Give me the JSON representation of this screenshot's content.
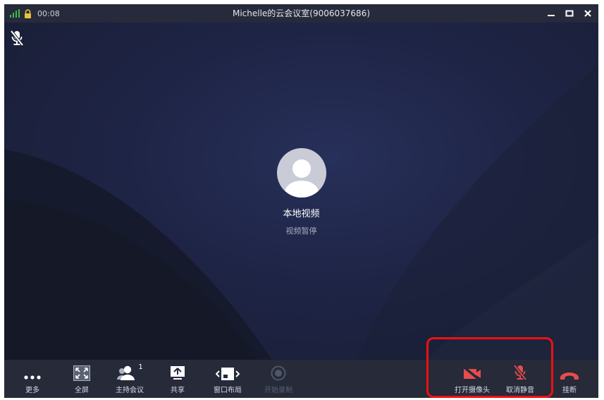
{
  "titlebar": {
    "timer": "00:08",
    "title": "Michelle的云会议室(9006037686)"
  },
  "stage": {
    "local_label": "本地视频",
    "local_status": "视频暂停"
  },
  "toolbar": {
    "more": "更多",
    "fullscreen": "全屏",
    "host": "主持会议",
    "host_badge": "1",
    "share": "共享",
    "layout": "窗口布局",
    "record": "开始录制",
    "camera": "打开摄像头",
    "unmute": "取消静音",
    "hangup": "挂断"
  },
  "colors": {
    "accent_red": "#e74c4c",
    "signal_green": "#3dbd4c",
    "lock_yellow": "#e8c23a",
    "highlight": "#ee1111"
  }
}
